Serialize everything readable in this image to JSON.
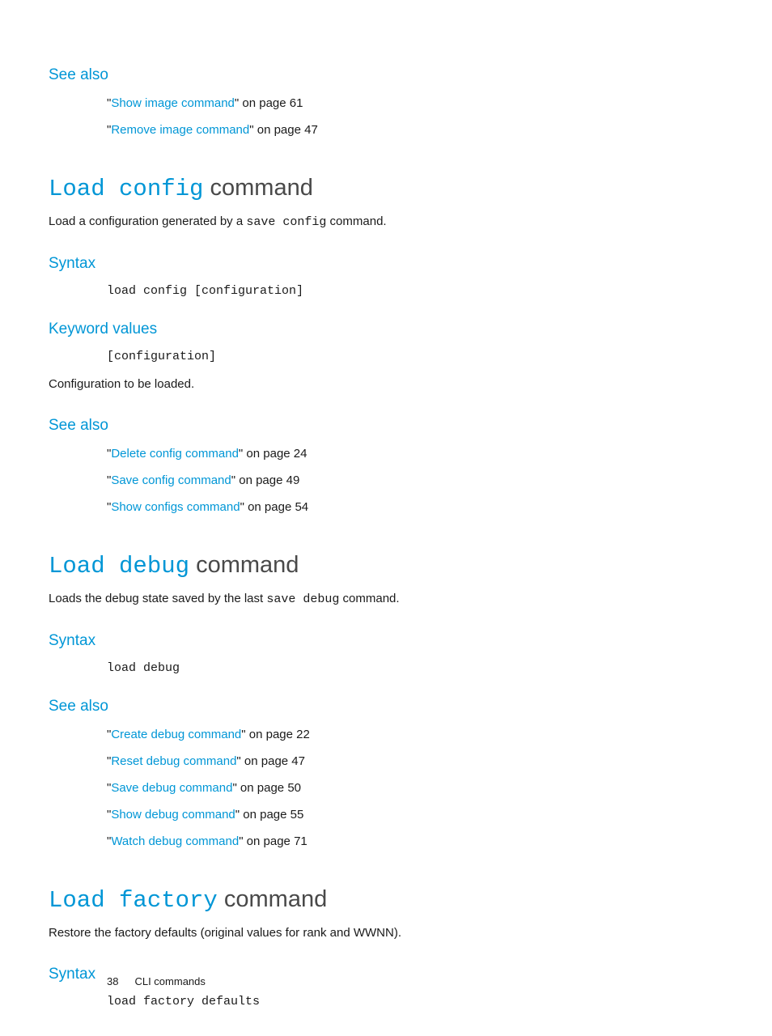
{
  "section_top": {
    "see_also_heading": "See also",
    "refs": [
      {
        "link": "Show image command",
        "tail": "\" on page 61"
      },
      {
        "link": "Remove image command",
        "tail": "\" on page 47"
      }
    ]
  },
  "load_config": {
    "title_mono": "Load config",
    "title_plain": " command",
    "desc_pre": "Load a configuration generated by a ",
    "desc_mono": "save config",
    "desc_post": " command.",
    "syntax_heading": "Syntax",
    "syntax_code": "load config [configuration]",
    "keyword_heading": "Keyword values",
    "keyword_code": "[configuration]",
    "keyword_desc": "Configuration to be loaded.",
    "see_also_heading": "See also",
    "refs": [
      {
        "link": "Delete config command",
        "tail": "\" on page 24"
      },
      {
        "link": "Save config command",
        "tail": "\" on page 49"
      },
      {
        "link": "Show configs command",
        "tail": "\" on page 54"
      }
    ]
  },
  "load_debug": {
    "title_mono": "Load debug",
    "title_plain": " command",
    "desc_pre": "Loads the debug state saved by the last ",
    "desc_mono": "save debug",
    "desc_post": " command.",
    "syntax_heading": "Syntax",
    "syntax_code": "load debug",
    "see_also_heading": "See also",
    "refs": [
      {
        "link": "Create debug command",
        "tail": "\" on page 22"
      },
      {
        "link": "Reset debug command",
        "tail": "\" on page 47"
      },
      {
        "link": "Save debug command",
        "tail": "\" on page 50"
      },
      {
        "link": "Show debug command",
        "tail": "\" on page 55"
      },
      {
        "link": "Watch debug command",
        "tail": "\" on page 71"
      }
    ]
  },
  "load_factory": {
    "title_mono": "Load factory",
    "title_plain": " command",
    "desc": "Restore the factory defaults (original values for rank and WWNN).",
    "syntax_heading": "Syntax",
    "syntax_code": "load factory defaults"
  },
  "footer": {
    "page_num": "38",
    "section": "CLI commands"
  }
}
